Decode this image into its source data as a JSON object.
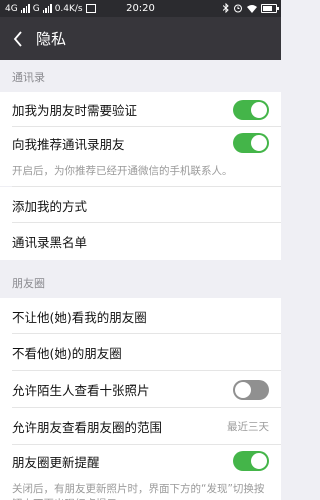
{
  "status_bar": {
    "network_1": "4G",
    "network_2": "G",
    "speed": "0.4K/s",
    "time": "20:20"
  },
  "nav": {
    "title": "隐私"
  },
  "sections": {
    "contacts": {
      "header": "通讯录",
      "verify_label": "加我为朋友时需要验证",
      "verify_on": true,
      "recommend_label": "向我推荐通讯录朋友",
      "recommend_on": true,
      "recommend_hint": "开启后，为你推荐已经开通微信的手机联系人。",
      "add_methods_label": "添加我的方式",
      "blacklist_label": "通讯录黑名单"
    },
    "moments": {
      "header": "朋友圈",
      "block_view_label": "不让他(她)看我的朋友圈",
      "hide_label": "不看他(她)的朋友圈",
      "stranger_ten_label": "允许陌生人查看十张照片",
      "stranger_ten_on": false,
      "range_label": "允许朋友查看朋友圈的范围",
      "range_value": "最近三天",
      "update_notify_label": "朋友圈更新提醒",
      "update_notify_on": true,
      "update_notify_hint": "关闭后，有朋友更新照片时，界面下方的“发现”切换按钮上不再出现红点提示。"
    }
  },
  "colors": {
    "toggle_on": "#44b549",
    "toggle_off": "#909090",
    "navbar": "#37363b"
  }
}
